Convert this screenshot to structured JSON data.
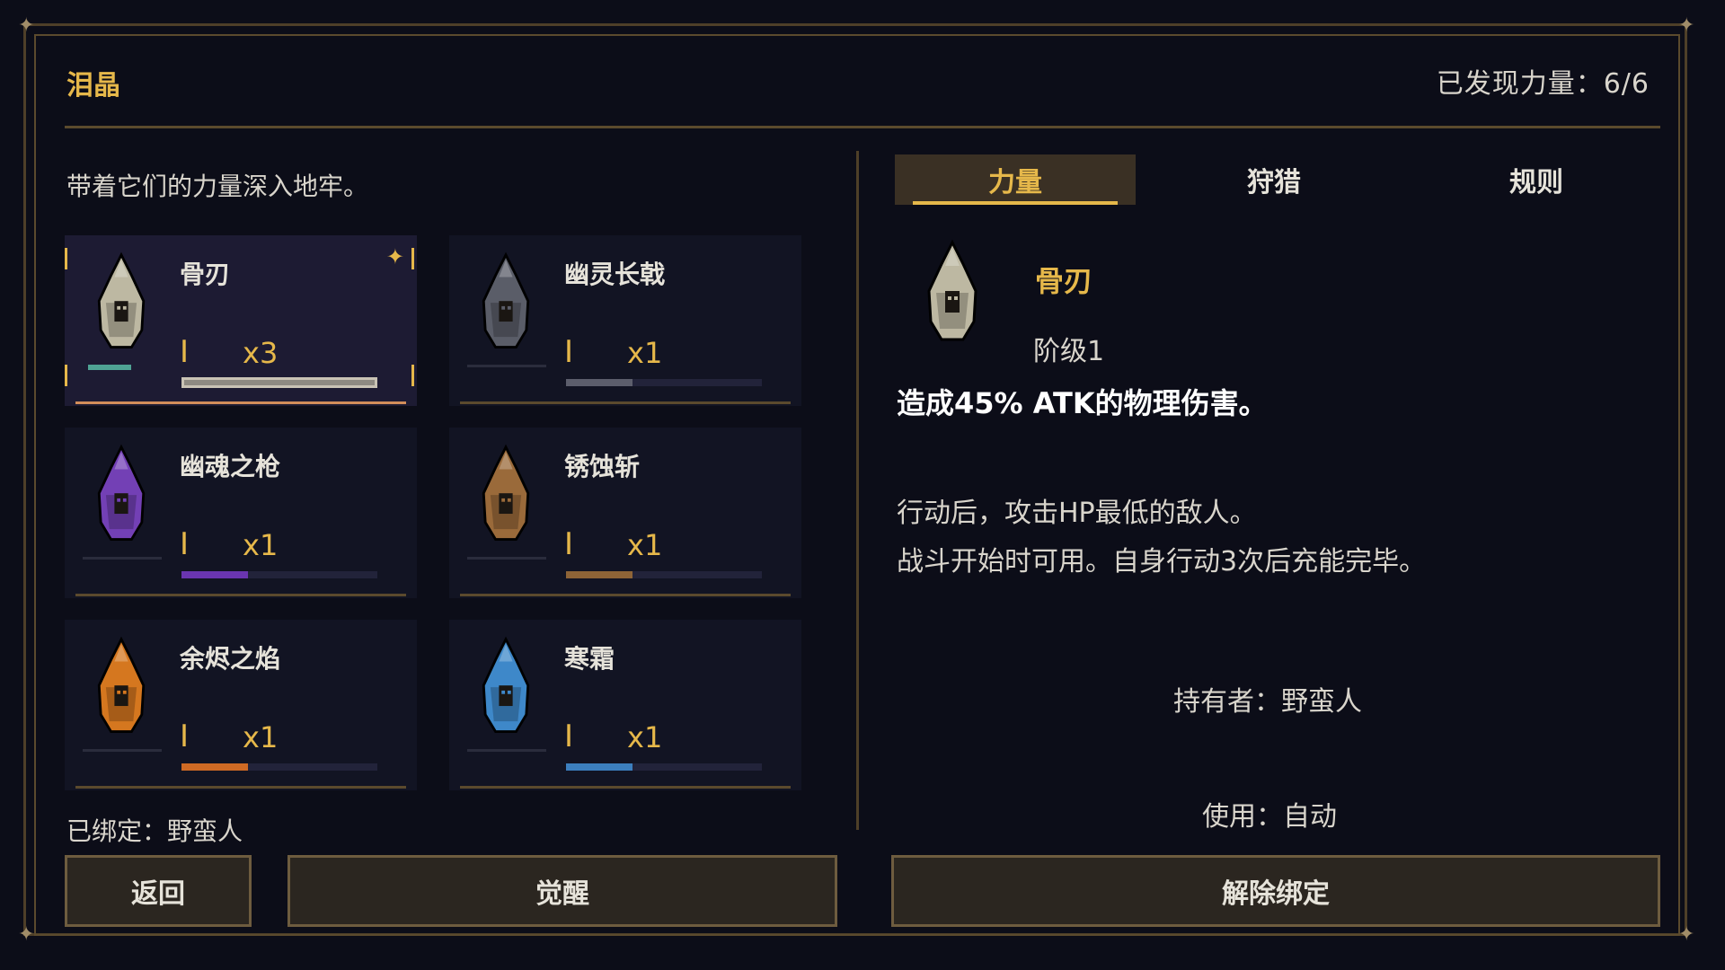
{
  "panel": {
    "title": "泪晶",
    "discovered": "已发现力量：6/6",
    "subtitle": "带着它们的力量深入地牢。",
    "bound_label": "已绑定：野蛮人"
  },
  "crystals": [
    {
      "name": "骨刃",
      "rank": "I",
      "count": "x3",
      "color": "#bdb8a2",
      "progress": 1.0,
      "bar_color": "#8e8a82",
      "accent": "#4fa394",
      "selected": true
    },
    {
      "name": "幽灵长戟",
      "rank": "I",
      "count": "x1",
      "color": "#5a5d68",
      "progress": 0.34,
      "bar_color": "#5c5e6c",
      "accent": "",
      "selected": false
    },
    {
      "name": "幽魂之枪",
      "rank": "I",
      "count": "x1",
      "color": "#7340b5",
      "progress": 0.34,
      "bar_color": "#6a35b0",
      "accent": "",
      "selected": false
    },
    {
      "name": "锈蚀斩",
      "rank": "I",
      "count": "x1",
      "color": "#9a6a3a",
      "progress": 0.34,
      "bar_color": "#8e6437",
      "accent": "",
      "selected": false
    },
    {
      "name": "余烬之焰",
      "rank": "I",
      "count": "x1",
      "color": "#d5771f",
      "progress": 0.34,
      "bar_color": "#cf6a24",
      "accent": "",
      "selected": false
    },
    {
      "name": "寒霜",
      "rank": "I",
      "count": "x1",
      "color": "#3e88c9",
      "progress": 0.34,
      "bar_color": "#3c7fbe",
      "accent": "",
      "selected": false
    }
  ],
  "buttons": {
    "back": "返回",
    "awaken": "觉醒",
    "unbind": "解除绑定"
  },
  "tabs": [
    {
      "label": "力量",
      "active": true
    },
    {
      "label": "狩猎",
      "active": false
    },
    {
      "label": "规则",
      "active": false
    }
  ],
  "detail": {
    "name": "骨刃",
    "tier": "阶级1",
    "description": "造成45% ATK的物理伤害。",
    "effect_line1": "行动后，攻击HP最低的敌人。",
    "effect_line2": "战斗开始时可用。自身行动3次后充能完毕。",
    "holder": "持有者：野蛮人",
    "usage": "使用：自动"
  },
  "colors": {
    "accent_gold": "#e6b84a",
    "frame_brown": "#5b4a2d",
    "background": "#0c0d18"
  }
}
